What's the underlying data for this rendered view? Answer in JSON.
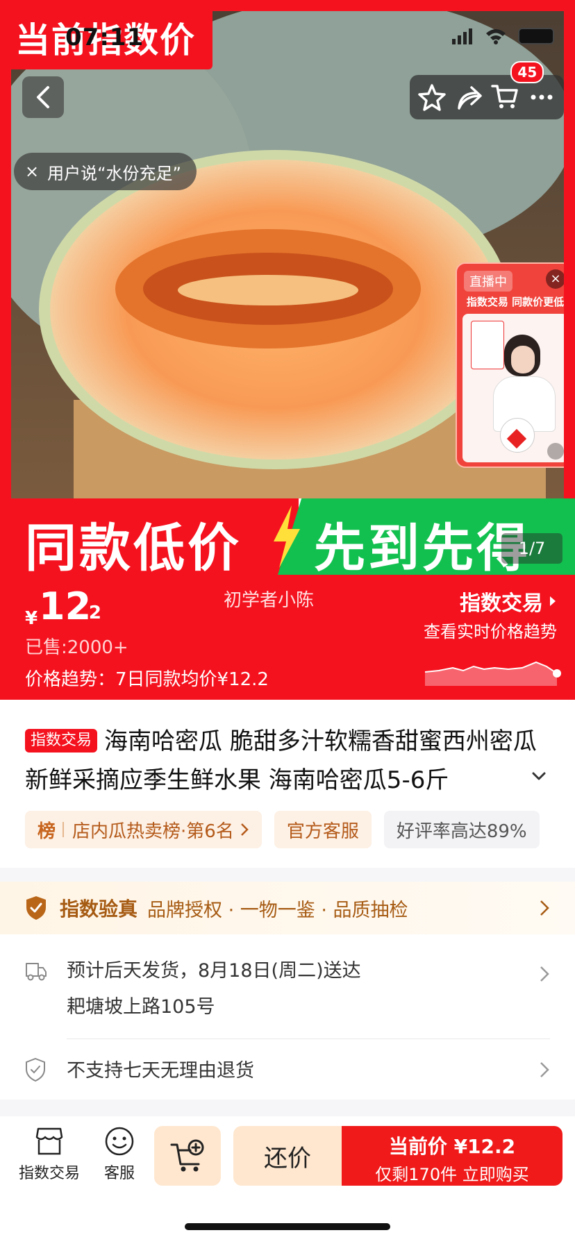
{
  "status_bar": {
    "time": "07:11"
  },
  "hero": {
    "corner_banner": "当前指数价",
    "user_says": "用户说“水份充足”",
    "cart_badge": "45",
    "image_counter": "1/7"
  },
  "live": {
    "tag": "直播中",
    "promo": "指数交易 同款价更低"
  },
  "promo_bar": {
    "left": "同款低价",
    "right": "先到先得",
    "colors": {
      "left": "#f5121f",
      "right": "#12c04f"
    }
  },
  "price": {
    "currency": "¥",
    "integer": "12",
    "decimal": ".2",
    "sold": "已售:2000+",
    "trend": "价格趋势：7日同款均价¥12.2",
    "seller": "初学者小陈",
    "index_trade": "指数交易",
    "index_trade_sub": "查看实时价格趋势"
  },
  "product": {
    "tag": "指数交易",
    "title": "海南哈密瓜 脆甜多汁软糯香甜蜜西州密瓜 新鲜采摘应季生鲜水果 海南哈密瓜5-6斤"
  },
  "chips": {
    "rank_badge": "榜",
    "rank_text": "店内瓜热卖榜·第6名",
    "service": "官方客服",
    "rating": "好评率高达89%"
  },
  "verify": {
    "title": "指数验真",
    "text": "品牌授权 · 一物一鉴 · 品质抽检"
  },
  "shipping": {
    "estimate": "预计后天发货，8月18日(周二)送达",
    "address": "耙塘坡上路105号"
  },
  "returns": {
    "text": "不支持七天无理由退货"
  },
  "bottom_bar": {
    "store_label": "指数交易",
    "service_label": "客服",
    "bargain_label": "还价",
    "buy_line1": "当前价 ¥12.2",
    "buy_line2": "仅剩170件 立即购买"
  },
  "theme": {
    "accent": "#f5121f",
    "gold": "#a65b13",
    "cream": "#ffe7cf"
  }
}
